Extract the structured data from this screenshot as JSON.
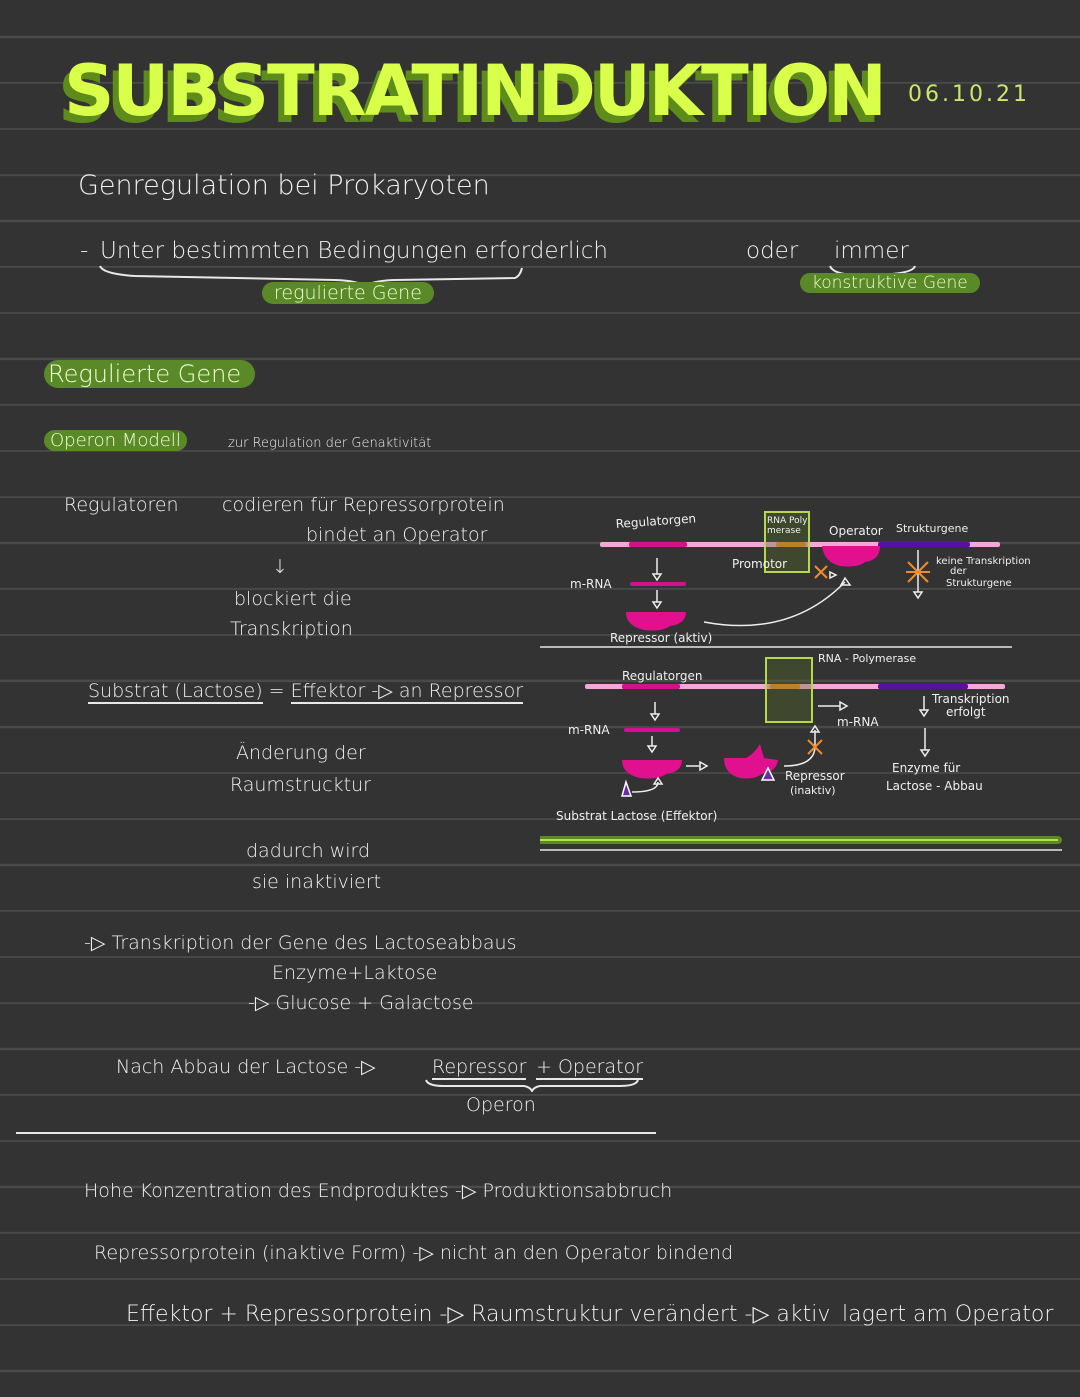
{
  "header": {
    "title": "SUBSTRATINDUKTION",
    "date": "06.10.21"
  },
  "intro": {
    "heading": "Genregulation bei Prokaryoten",
    "line_prefix": "-",
    "line_text": "Unter bestimmten Bedingungen erforderlich",
    "line_or": "oder",
    "line_always": "immer",
    "tag_regulated": "regulierte Gene",
    "tag_constitutive": "konstruktive Gene"
  },
  "regulated": {
    "heading": "Regulierte Gene",
    "operon_tag": "Operon Modell",
    "operon_desc": "zur Regulation der Genaktivität",
    "regulators": "Regulatoren",
    "codes_for": "codieren für Repressorprotein",
    "binds": "bindet an Operator",
    "arrow": "↓",
    "blocks_1": "blockiert die",
    "blocks_2": "Transkription",
    "substrate_line_a": "Substrat (Lactose)",
    "substrate_line_eq": "=",
    "substrate_line_b": "Effektor -▷ an Repressor",
    "change_1": "Änderung der",
    "change_2": "Raumstrucktur",
    "inactivated_1": "dadurch wird",
    "inactivated_2": "sie inaktiviert",
    "transcription_line": "-▷ Transkription der Gene des Lactoseabbaus",
    "enzyme_line": "Enzyme+Laktose",
    "products_line": "-▷ Glucose + Galactose",
    "after_prefix": "Nach Abbau der Lactose -▷",
    "after_repressor": "Repressor",
    "after_operator": "+ Operator",
    "operon_label": "Operon"
  },
  "diagram_top": {
    "regulatorgen": "Regulatorgen",
    "rna_polymerase_1": "RNA Poly",
    "rna_polymerase_2": "merase",
    "promotor": "Promotor",
    "operator": "Operator",
    "strukturgene": "Strukturgene",
    "mrna": "m-RNA",
    "repressor_active": "Repressor (aktiv)",
    "no_transcription_1": "keine Transkription",
    "no_transcription_2": "der",
    "no_transcription_3": "Strukturgene"
  },
  "diagram_bottom": {
    "regulatorgen": "Regulatorgen",
    "rna_polymerase": "RNA - Polymerase",
    "mrna_left": "m-RNA",
    "mrna_right": "m-RNA",
    "transcription_1": "Transkription",
    "transcription_2": "erfolgt",
    "repressor_inactive_1": "Repressor",
    "repressor_inactive_2": "(inaktiv)",
    "enzymes_1": "Enzyme für",
    "enzymes_2": "Lactose - Abbau",
    "substrate": "Substrat Lactose (Effektor)"
  },
  "end_product": {
    "line1": "Hohe Konzentration des Endproduktes -▷ Produktionsabbruch",
    "line2": "Repressorprotein (inaktive Form) -▷ nicht an den Operator bindend",
    "line3": "Effektor + Repressorprotein -▷ Raumstruktur verändert -▷ aktiv",
    "line3_right": "lagert am Operator"
  },
  "colors": {
    "background": "#333333",
    "title": "#d9ff4a",
    "title_shadow": "#5e8c1a",
    "highlight": "#5a8a28",
    "dna": "#f5a8d8",
    "regulator_gene": "#d4108f",
    "promotor": "#f08a2c",
    "structural_genes": "#5a0fa0",
    "repressor": "#e0108f",
    "effector": "#6a2bb0",
    "polymerase_box": "#b8d84a"
  }
}
